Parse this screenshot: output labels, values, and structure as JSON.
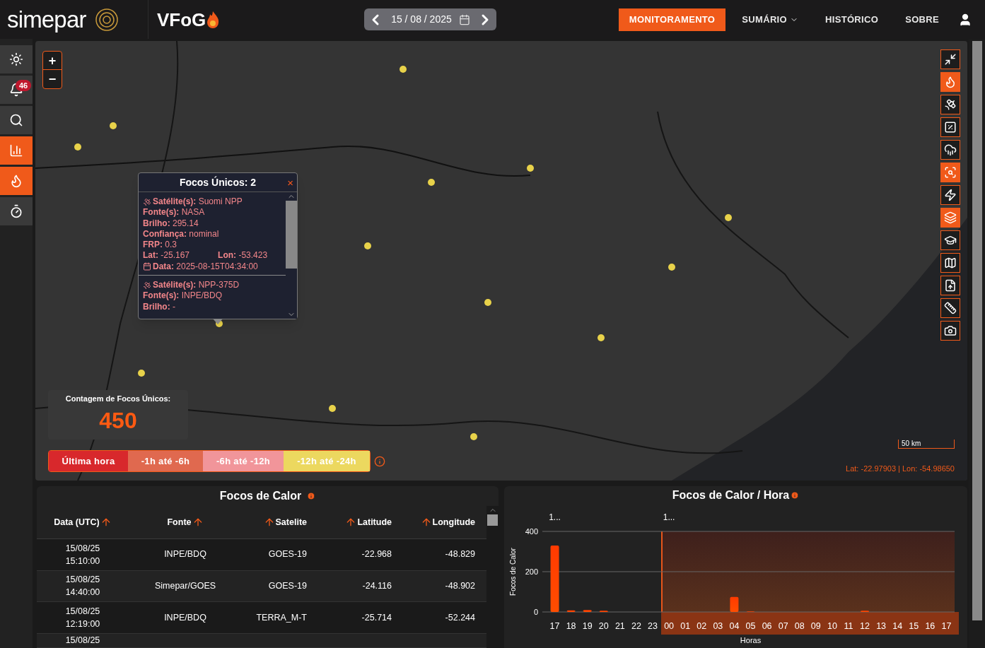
{
  "header": {
    "logo": "simepar",
    "app_logo": "VFoG",
    "date": "15 / 08 / 2025",
    "nav": [
      {
        "label": "MONITORAMENTO",
        "selected": true,
        "dropdown": false
      },
      {
        "label": "SUMÁRIO",
        "selected": false,
        "dropdown": true
      },
      {
        "label": "HISTÓRICO",
        "selected": false,
        "dropdown": false
      },
      {
        "label": "SOBRE",
        "selected": false,
        "dropdown": false
      }
    ]
  },
  "sidebar": {
    "items": [
      {
        "kind": "sun",
        "active": false
      },
      {
        "kind": "bell",
        "active": false,
        "badge": "46"
      },
      {
        "kind": "search",
        "active": false
      },
      {
        "kind": "chart",
        "active": true
      },
      {
        "kind": "flame",
        "active": true
      },
      {
        "kind": "timer",
        "active": false
      }
    ]
  },
  "map": {
    "zoom_in": "+",
    "zoom_out": "−",
    "popup": {
      "title": "Focos Únicos: 2",
      "close": "×",
      "entries": [
        {
          "lines": [
            "**Satélite(s):** Suomi NPP",
            "**Fonte(s):** NASA",
            "**Brilho:** 295.14",
            "**Confiança:** nominal",
            "**FRP:** 0.3"
          ],
          "coords": [
            "**Lat:** -25.167",
            "**Lon:** -53.423"
          ],
          "date": "**Data:** 2025-08-15T04:34:00"
        },
        {
          "lines": [
            "**Satélite(s):** NPP-375D",
            "**Fonte(s):** INPE/BDQ",
            "**Brilho:** -"
          ]
        }
      ]
    },
    "count": {
      "label": "Contagem de Focos Únicos:",
      "value": "450"
    },
    "legend": [
      {
        "label": "Última hora",
        "color": "#d8282c"
      },
      {
        "label": "-1h até -6h",
        "color": "#e0694f"
      },
      {
        "label": "-6h até -12h",
        "color": "#f1959a"
      },
      {
        "label": "-12h até -24h",
        "color": "#ecd85f"
      }
    ],
    "toolbar": [
      {
        "kind": "shrink",
        "active": false
      },
      {
        "kind": "flame",
        "active": true
      },
      {
        "kind": "satellite",
        "active": false
      },
      {
        "kind": "percent",
        "active": false
      },
      {
        "kind": "cloud",
        "active": false
      },
      {
        "kind": "map-search",
        "active": true
      },
      {
        "kind": "lightning",
        "active": false
      },
      {
        "kind": "layers",
        "active": true
      },
      {
        "kind": "graduation-cap",
        "active": false
      },
      {
        "kind": "map",
        "active": false
      },
      {
        "kind": "file-upload",
        "active": false
      },
      {
        "kind": "ruler",
        "active": false
      },
      {
        "kind": "camera",
        "active": false
      }
    ],
    "scale": "50 km",
    "coordinates": "Lat: -22.97903 | Lon: -54.98650"
  },
  "table": {
    "title": "Focos de Calor",
    "columns": [
      {
        "label": "Data (UTC)"
      },
      {
        "label": "Fonte"
      },
      {
        "label": "Satelite"
      },
      {
        "label": "Latitude"
      },
      {
        "label": "Longitude"
      }
    ],
    "rows": [
      {
        "date": "15/08/25",
        "time": "15:10:00",
        "source": "INPE/BDQ",
        "satellite": "GOES-19",
        "latitude": "-22.968",
        "longitude": "-48.829"
      },
      {
        "date": "15/08/25",
        "time": "14:40:00",
        "source": "Simepar/GOES",
        "satellite": "GOES-19",
        "latitude": "-24.116",
        "longitude": "-48.902"
      },
      {
        "date": "15/08/25",
        "time": "12:19:00",
        "source": "INPE/BDQ",
        "satellite": "TERRA_M-T",
        "latitude": "-25.714",
        "longitude": "-52.244"
      },
      {
        "date": "15/08/25"
      }
    ]
  },
  "chart": {
    "title": "Focos de Calor / Hora",
    "chart_data": {
      "type": "bar",
      "ylabel": "Focos de Calor",
      "xlabel": "Horas",
      "categories": [
        "17",
        "18",
        "19",
        "20",
        "21",
        "22",
        "23",
        "00",
        "01",
        "02",
        "03",
        "04",
        "05",
        "06",
        "07",
        "08",
        "09",
        "10",
        "11",
        "12",
        "13",
        "14",
        "15",
        "16",
        "17"
      ],
      "series": [
        {
          "color": "#ff4d00",
          "values": [
            330,
            8,
            10,
            6,
            0,
            0,
            0,
            0,
            0,
            0,
            0,
            75,
            3,
            0,
            0,
            0,
            0,
            0,
            0,
            6,
            0,
            0,
            0,
            0,
            0
          ]
        }
      ],
      "ylim": [
        0,
        400
      ],
      "yticks": [
        0,
        200,
        400
      ],
      "annotations": [
        "1...",
        "1..."
      ]
    }
  }
}
